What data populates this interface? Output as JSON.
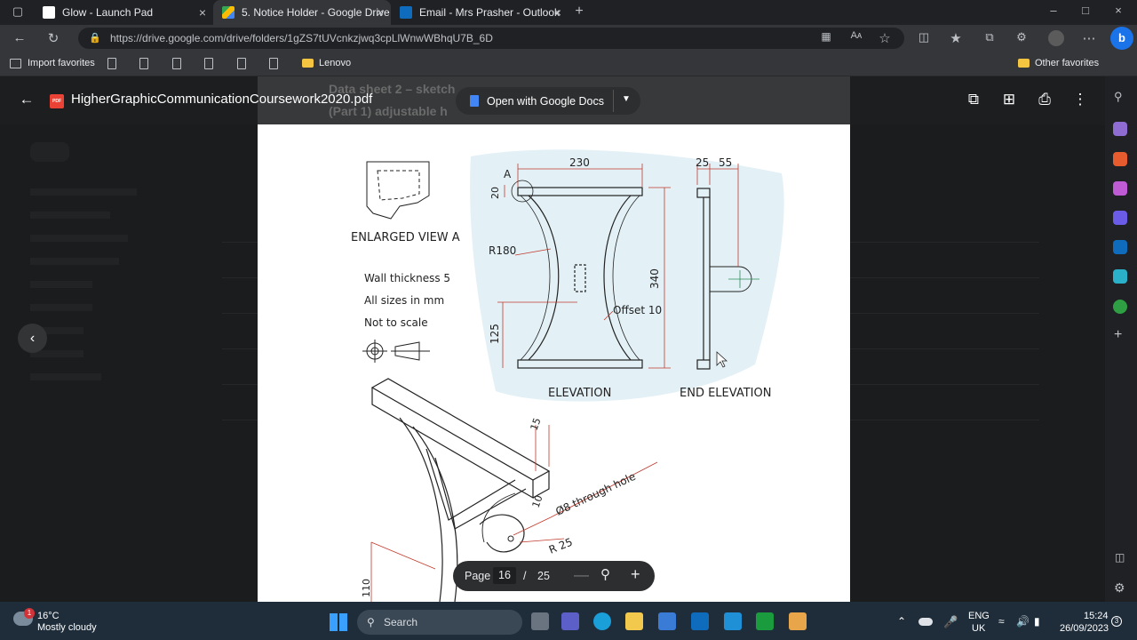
{
  "browser": {
    "tabs": [
      {
        "title": "Glow - Launch Pad",
        "color": "#ffffff"
      },
      {
        "title": "5. Notice Holder - Google Drive",
        "color": "#34a853"
      },
      {
        "title": "Email - Mrs Prasher - Outlook",
        "color": "#0f6cbd"
      }
    ],
    "url": "https://drive.google.com/drive/folders/1gZS7tUVcnkzjwq3cpLlWnwWBhqU7B_6D",
    "bookmarks": {
      "import": "Import favorites",
      "lenovo": "Lenovo",
      "other": "Other favorites"
    }
  },
  "viewer": {
    "filename": "HigherGraphicCommunicationCoursework2020.pdf",
    "pdf_badge": "PDF",
    "open_with": "Open with Google Docs",
    "behind_title_1": "Data sheet 2 – sketch",
    "behind_title_2": "(Part 1) adjustable h",
    "page_label": "Page",
    "current_page": "16",
    "total_pages": "25"
  },
  "drawing": {
    "enlarged_view": "ENLARGED VIEW A",
    "notes": [
      "Wall thickness 5",
      "All sizes in mm",
      "Not to scale"
    ],
    "dims": {
      "d230": "230",
      "d25": "25",
      "d55": "55",
      "d20": "20",
      "d340": "340",
      "d125": "125",
      "r180": "R180",
      "offset": "Offset 10",
      "a": "A",
      "d15": "15",
      "d10": "10",
      "d110": "110",
      "r25": "R 25",
      "hole": "Ø8 through hole"
    },
    "elevation": "ELEVATION",
    "end_elevation": "END ELEVATION"
  },
  "taskbar": {
    "temp": "16°C",
    "weather": "Mostly cloudy",
    "weather_badge": "1",
    "search": "Search",
    "lang1": "ENG",
    "lang2": "UK",
    "time": "15:24",
    "date": "26/09/2023",
    "notif": "3"
  }
}
